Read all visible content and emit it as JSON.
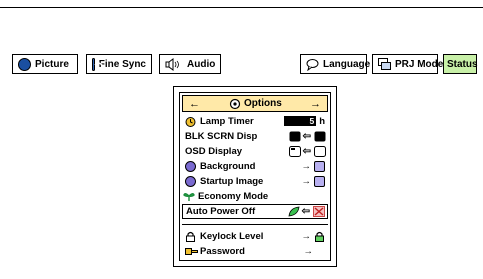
{
  "tabs": [
    {
      "label": "Picture",
      "icon": "picture-icon"
    },
    {
      "label": "Fine Sync",
      "icon": "fine-sync-icon"
    },
    {
      "label": "Audio",
      "icon": "speaker-icon"
    },
    {
      "label": "Language",
      "icon": "speech-bubble-icon"
    },
    {
      "label": "PRJ Mode",
      "icon": "projector-mode-icon"
    },
    {
      "label": "Status",
      "icon": ""
    }
  ],
  "options_menu": {
    "title": "Options",
    "left_arrow": "←",
    "right_arrow": "→",
    "lamp_timer": {
      "label": "Lamp Timer",
      "value": "5",
      "unit": "h"
    },
    "blk_scrn": {
      "label": "BLK SCRN Disp",
      "arrow": "⇦"
    },
    "osd_display": {
      "label": "OSD Display",
      "arrow": "⇦"
    },
    "background": {
      "label": "Background",
      "arrow": "→"
    },
    "startup_image": {
      "label": "Startup Image",
      "arrow": "→"
    },
    "economy_mode": {
      "label": "Economy Mode"
    },
    "auto_power_off": {
      "label": "Auto Power Off",
      "arrow": "⇦"
    },
    "keylock_level": {
      "label": "Keylock Level",
      "arrow": "→"
    },
    "password": {
      "label": "Password",
      "arrow": "→"
    }
  },
  "colors": {
    "active_tab": "#c8f0a8",
    "menu_header": "#ffe9a8",
    "accent_blue": "#2a5fb0"
  }
}
